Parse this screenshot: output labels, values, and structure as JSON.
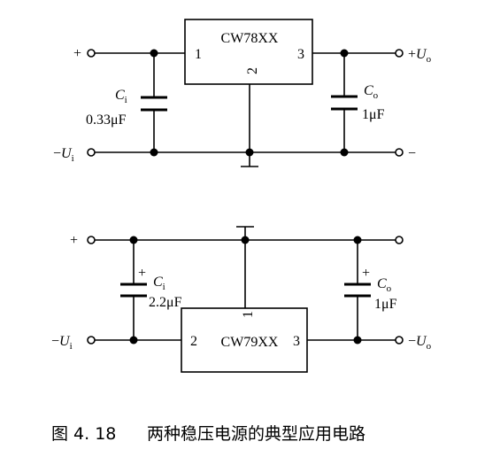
{
  "top_circuit": {
    "ic_label": "CW78XX",
    "pin_in": "1",
    "pin_out": "3",
    "pin_gnd": "2",
    "input_plus": "+",
    "output_plus": "+",
    "output_symbol": "U",
    "output_sub": "o",
    "input_minus": "−",
    "input_symbol": "U",
    "input_sub": "i",
    "output_minus": "−",
    "ci_symbol": "C",
    "ci_sub": "i",
    "ci_value": "0.33μF",
    "co_symbol": "C",
    "co_sub": "o",
    "co_value": "1μF"
  },
  "bottom_circuit": {
    "ic_label": "CW79XX",
    "pin_in": "2",
    "pin_out": "3",
    "pin_gnd": "1",
    "top_plus": "+",
    "input_minus": "−",
    "input_symbol": "U",
    "input_sub": "i",
    "output_minus": "−",
    "output_symbol": "U",
    "output_sub": "o",
    "ci_polarity": "+",
    "ci_symbol": "C",
    "ci_sub": "i",
    "ci_value": "2.2μF",
    "co_polarity": "+",
    "co_symbol": "C",
    "co_sub": "o",
    "co_value": "1μF"
  },
  "caption": {
    "number": "图 4. 18",
    "text": "两种稳压电源的典型应用电路"
  }
}
